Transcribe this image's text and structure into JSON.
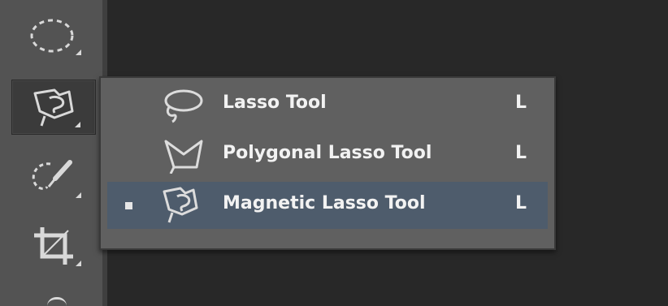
{
  "toolbar": {
    "tools": [
      {
        "name": "marquee",
        "icon": "elliptical-marquee-icon",
        "active": false
      },
      {
        "name": "lasso",
        "icon": "magnetic-lasso-icon",
        "active": true
      },
      {
        "name": "quick-selection",
        "icon": "quick-selection-icon",
        "active": false
      },
      {
        "name": "crop",
        "icon": "crop-icon",
        "active": false
      }
    ]
  },
  "flyout": {
    "items": [
      {
        "label": "Lasso Tool",
        "shortcut": "L",
        "icon": "lasso-icon",
        "selected": false
      },
      {
        "label": "Polygonal Lasso Tool",
        "shortcut": "L",
        "icon": "polygonal-lasso-icon",
        "selected": false
      },
      {
        "label": "Magnetic Lasso Tool",
        "shortcut": "L",
        "icon": "magnetic-lasso-icon",
        "selected": true
      }
    ]
  },
  "colors": {
    "toolbar_bg": "#535353",
    "canvas_bg": "#282828",
    "flyout_bg": "#606060",
    "selected_bg": "#4e5c6c",
    "text": "#f2f2f2"
  }
}
